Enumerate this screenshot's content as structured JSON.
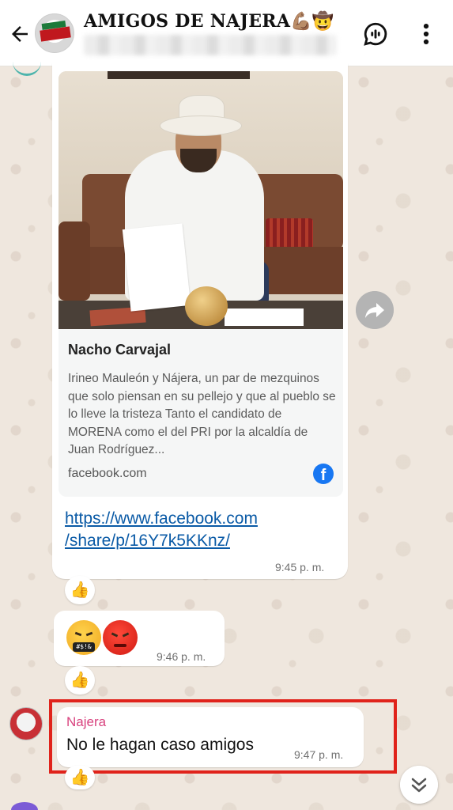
{
  "header": {
    "title": "AMIGOS DE NAJERA💪🏽🤠",
    "subtitle": "+52 ... 393 ... 1764, +52 ... 393 ..."
  },
  "messages": {
    "link_preview": {
      "title": "Nacho Carvajal",
      "description": "Irineo Mauleón y Nájera, un par de mezquinos que solo piensan en su pellejo y que al pueblo se lo lleve la tristeza Tanto el candidato de MORENA como el del PRI por la alcaldía de Juan Rodríguez...",
      "domain": "facebook.com",
      "link_line1": "https://www.facebook.com",
      "link_line2": "/share/p/16Y7k5KKnz/",
      "time": "9:45 p. m.",
      "reaction": "👍"
    },
    "emoji_message": {
      "emoji_mouth_text": "#$!&",
      "time": "9:46 p. m.",
      "reaction": "👍"
    },
    "najera_message": {
      "sender": "Najera",
      "text": "No le hagan caso amigos",
      "time": "9:47 p. m.",
      "reaction": "👍"
    }
  },
  "icons": {
    "back": "arrow-left-icon",
    "call": "group-call-icon",
    "menu": "more-vertical-icon",
    "forward": "forward-icon",
    "scroll": "chevron-double-down-icon",
    "facebook": "facebook-icon"
  },
  "colors": {
    "accent_link": "#0a5aa6",
    "sender_name": "#d8427e",
    "highlight_box": "#e0231b",
    "facebook_blue": "#1877f2",
    "wallpaper": "#efe7de"
  }
}
